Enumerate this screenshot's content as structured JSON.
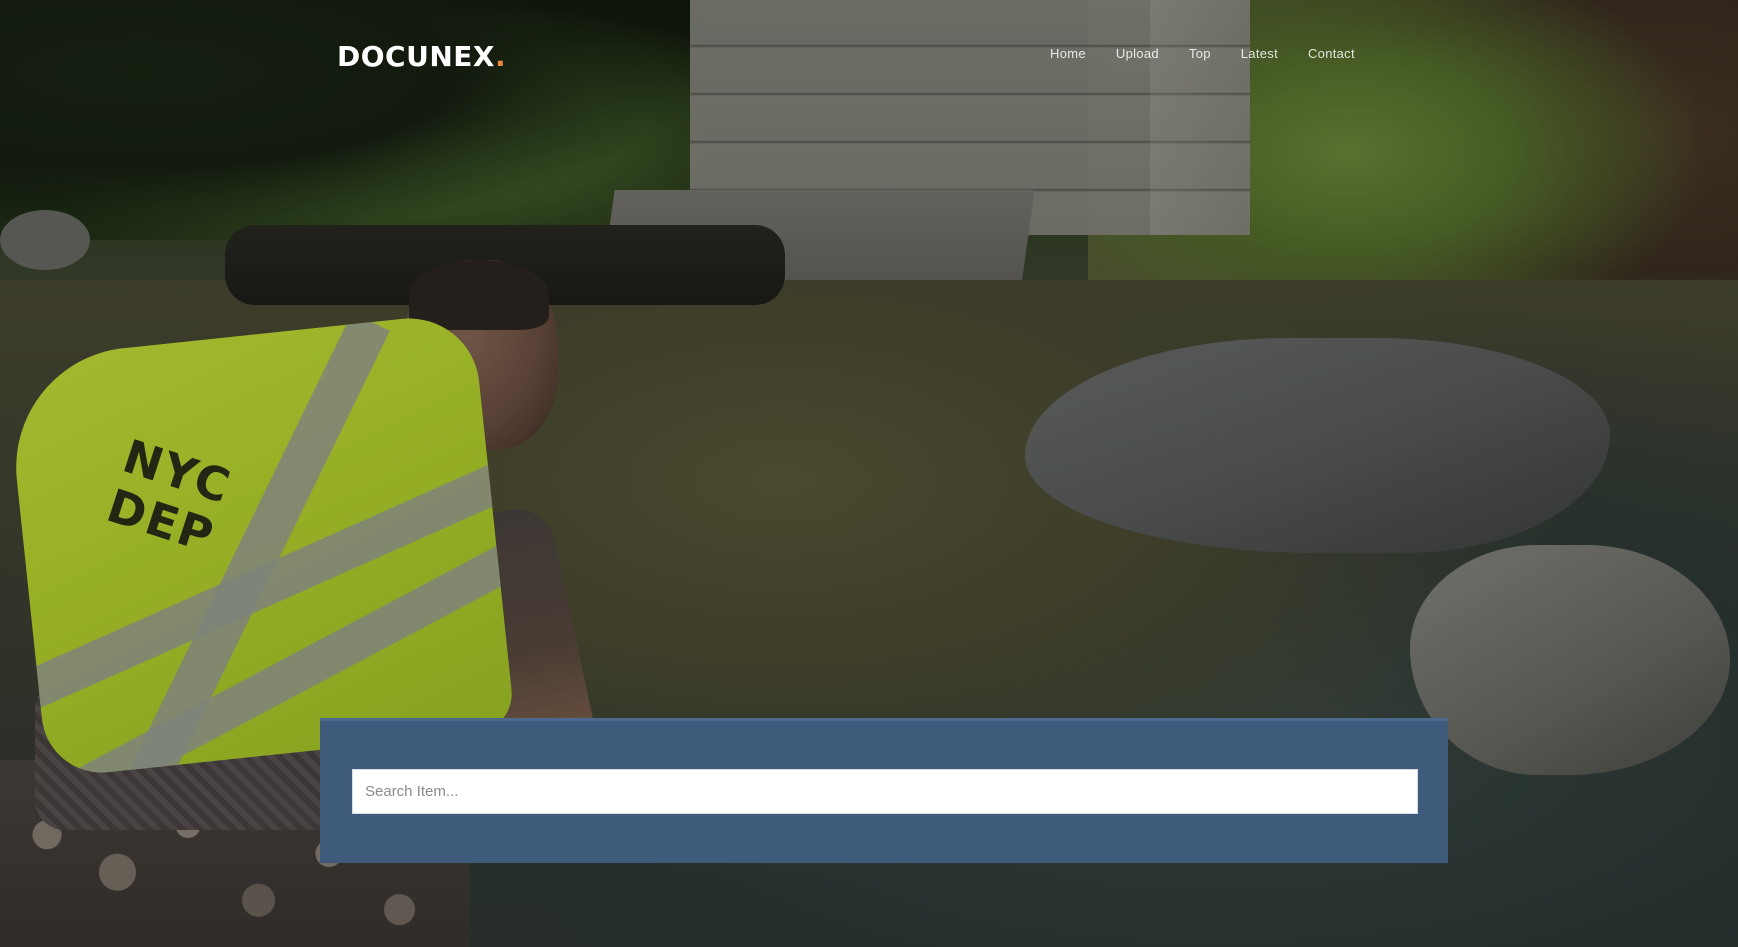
{
  "site": {
    "logo_text": "DOCUNEX",
    "logo_dot": ".",
    "accent_color": "#e8893a",
    "panel_color": "#3f5b7c"
  },
  "nav": {
    "items": [
      {
        "label": "Home"
      },
      {
        "label": "Upload"
      },
      {
        "label": "Top"
      },
      {
        "label": "Latest"
      },
      {
        "label": "Contact"
      }
    ]
  },
  "hero": {
    "vest_text_line1": "NYC",
    "vest_text_line2": "DEP"
  },
  "search": {
    "placeholder": "Search Item...",
    "value": ""
  }
}
